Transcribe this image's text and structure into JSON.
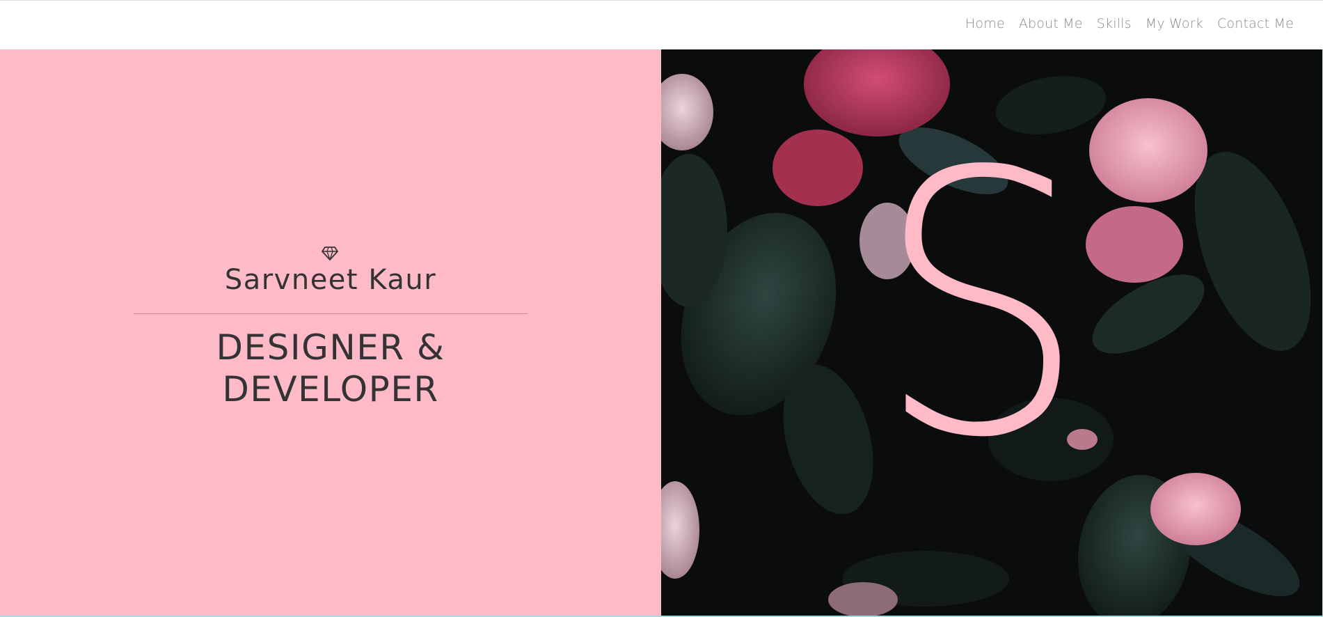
{
  "nav": {
    "links": [
      {
        "label": "Home"
      },
      {
        "label": "About Me"
      },
      {
        "label": "Skills"
      },
      {
        "label": "My Work"
      },
      {
        "label": "Contact Me"
      }
    ]
  },
  "hero": {
    "icon": "gem-icon",
    "name": "Sarvneet Kaur",
    "role_line1": "DESIGNER &",
    "role_line2": "DEVELOPER",
    "monogram": "S",
    "image": "dark-pink-flowers-photo"
  },
  "colors": {
    "accent_pink": "#ffbac8",
    "text_dark": "#333333",
    "nav_text": "#8a8a8a",
    "photo_background": "#0c0d0d"
  }
}
